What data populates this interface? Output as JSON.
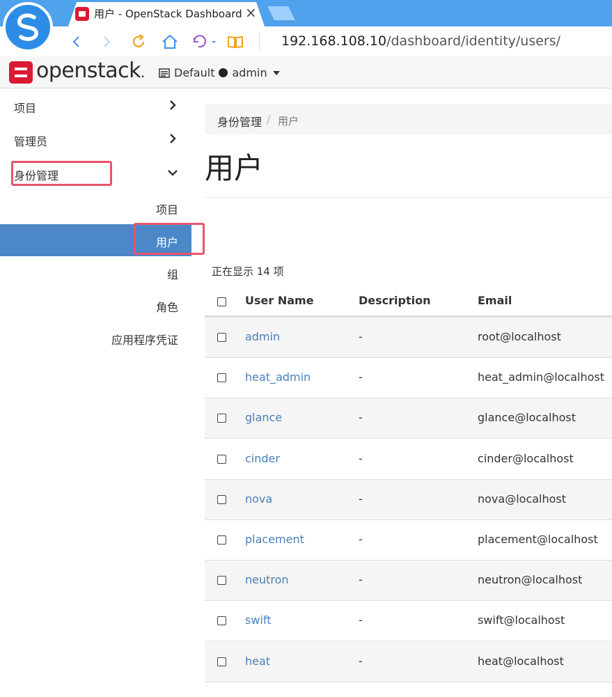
{
  "browser": {
    "tab_title": "用户 - OpenStack Dashboard",
    "tab_close": "×",
    "url_host": "192.168.108.10",
    "url_path": "/dashboard/identity/users/"
  },
  "header": {
    "brand": "openstack",
    "brand_mark": ".",
    "domain": "Default",
    "project": "admin"
  },
  "sidebar": {
    "sections": [
      {
        "label": "项目"
      },
      {
        "label": "管理员"
      },
      {
        "label": "身份管理"
      }
    ],
    "sub_items": [
      {
        "label": "项目"
      },
      {
        "label": "用户"
      },
      {
        "label": "组"
      },
      {
        "label": "角色"
      },
      {
        "label": "应用程序凭证"
      }
    ]
  },
  "main": {
    "breadcrumb": [
      "身份管理",
      "/",
      "用户"
    ],
    "title": "用户",
    "count_text": "正在显示 14 项",
    "table": {
      "columns": [
        "User Name",
        "Description",
        "Email"
      ],
      "rows": [
        {
          "name": "admin",
          "description": "-",
          "email": "root@localhost"
        },
        {
          "name": "heat_admin",
          "description": "-",
          "email": "heat_admin@localhost"
        },
        {
          "name": "glance",
          "description": "-",
          "email": "glance@localhost"
        },
        {
          "name": "cinder",
          "description": "-",
          "email": "cinder@localhost"
        },
        {
          "name": "nova",
          "description": "-",
          "email": "nova@localhost"
        },
        {
          "name": "placement",
          "description": "-",
          "email": "placement@localhost"
        },
        {
          "name": "neutron",
          "description": "-",
          "email": "neutron@localhost"
        },
        {
          "name": "swift",
          "description": "-",
          "email": "swift@localhost"
        },
        {
          "name": "heat",
          "description": "-",
          "email": "heat@localhost"
        }
      ]
    }
  },
  "colors": {
    "titlebar": "#4fa2ec",
    "brand_red": "#da1a32",
    "active_nav": "#4c88c8",
    "link": "#4a7fb4",
    "highlight": "#e8546b"
  }
}
